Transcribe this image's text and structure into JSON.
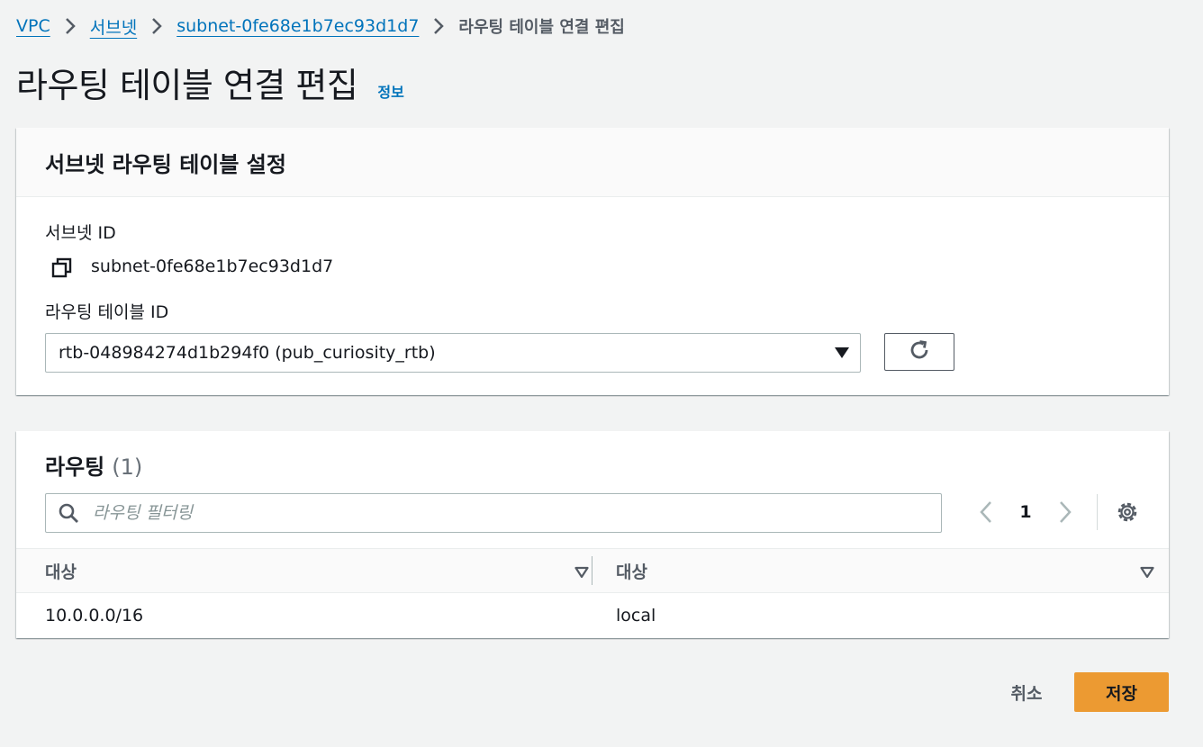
{
  "breadcrumb": {
    "items": [
      "VPC",
      "서브넷",
      "subnet-0fe68e1b7ec93d1d7"
    ],
    "current": "라우팅 테이블 연결 편집"
  },
  "page": {
    "title": "라우팅 테이블 연결 편집",
    "info_link": "정보"
  },
  "settings_panel": {
    "title": "서브넷 라우팅 테이블 설정",
    "subnet_id_label": "서브넷 ID",
    "subnet_id_value": "subnet-0fe68e1b7ec93d1d7",
    "route_table_id_label": "라우팅 테이블 ID",
    "route_table_selected": "rtb-048984274d1b294f0 (pub_curiosity_rtb)"
  },
  "routes_panel": {
    "title": "라우팅",
    "count": "(1)",
    "filter_placeholder": "라우팅 필터링",
    "filter_value": "",
    "current_page": "1",
    "columns": [
      "대상",
      "대상"
    ],
    "rows": [
      [
        "10.0.0.0/16",
        "local"
      ]
    ]
  },
  "actions": {
    "cancel_label": "취소",
    "save_label": "저장"
  },
  "icons": {
    "copy": "copy-icon",
    "refresh": "refresh-icon",
    "search": "search-icon",
    "settings": "gear-icon"
  },
  "colors": {
    "link": "#0073bb",
    "primary_button": "#ec9a32",
    "background": "#f2f3f3"
  }
}
